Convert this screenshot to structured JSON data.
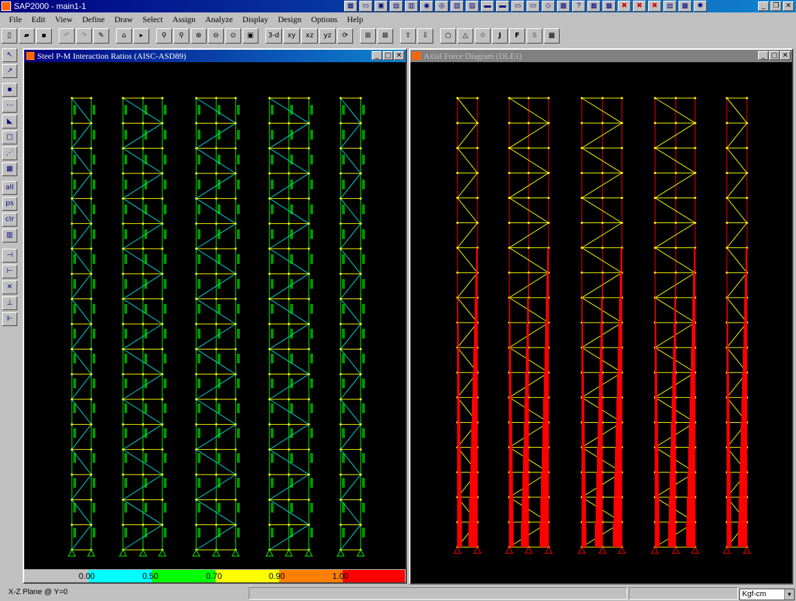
{
  "titlebar": {
    "title": "SAP2000 - main1-1"
  },
  "menu": [
    "File",
    "Edit",
    "View",
    "Define",
    "Draw",
    "Select",
    "Assign",
    "Analyze",
    "Display",
    "Design",
    "Options",
    "Help"
  ],
  "toolbar": {
    "view_3d": "3-d",
    "view_xy": "xy",
    "view_xz": "xz",
    "view_yz": "yz"
  },
  "left_window": {
    "title": "Steel P-M Interaction Ratios  (AISC-ASD89)",
    "frame_color": "#00ff00",
    "brace_color": "#00e0e0",
    "beam_color": "#ffff00"
  },
  "right_window": {
    "title": "Axial Force Diagram   (DLE1)",
    "frame_color": "#ffff00",
    "force_color": "#ff0000"
  },
  "legend": {
    "labels": [
      "0.00",
      "0.50",
      "0.70",
      "0.90",
      "1.00"
    ],
    "colors": [
      "#c0c0c0",
      "#00ffff",
      "#00ff00",
      "#ffff00",
      "#ff8000",
      "#ff0000"
    ]
  },
  "status": {
    "text": "X-Z Plane @ Y=0",
    "units": "Kgf-cm"
  }
}
